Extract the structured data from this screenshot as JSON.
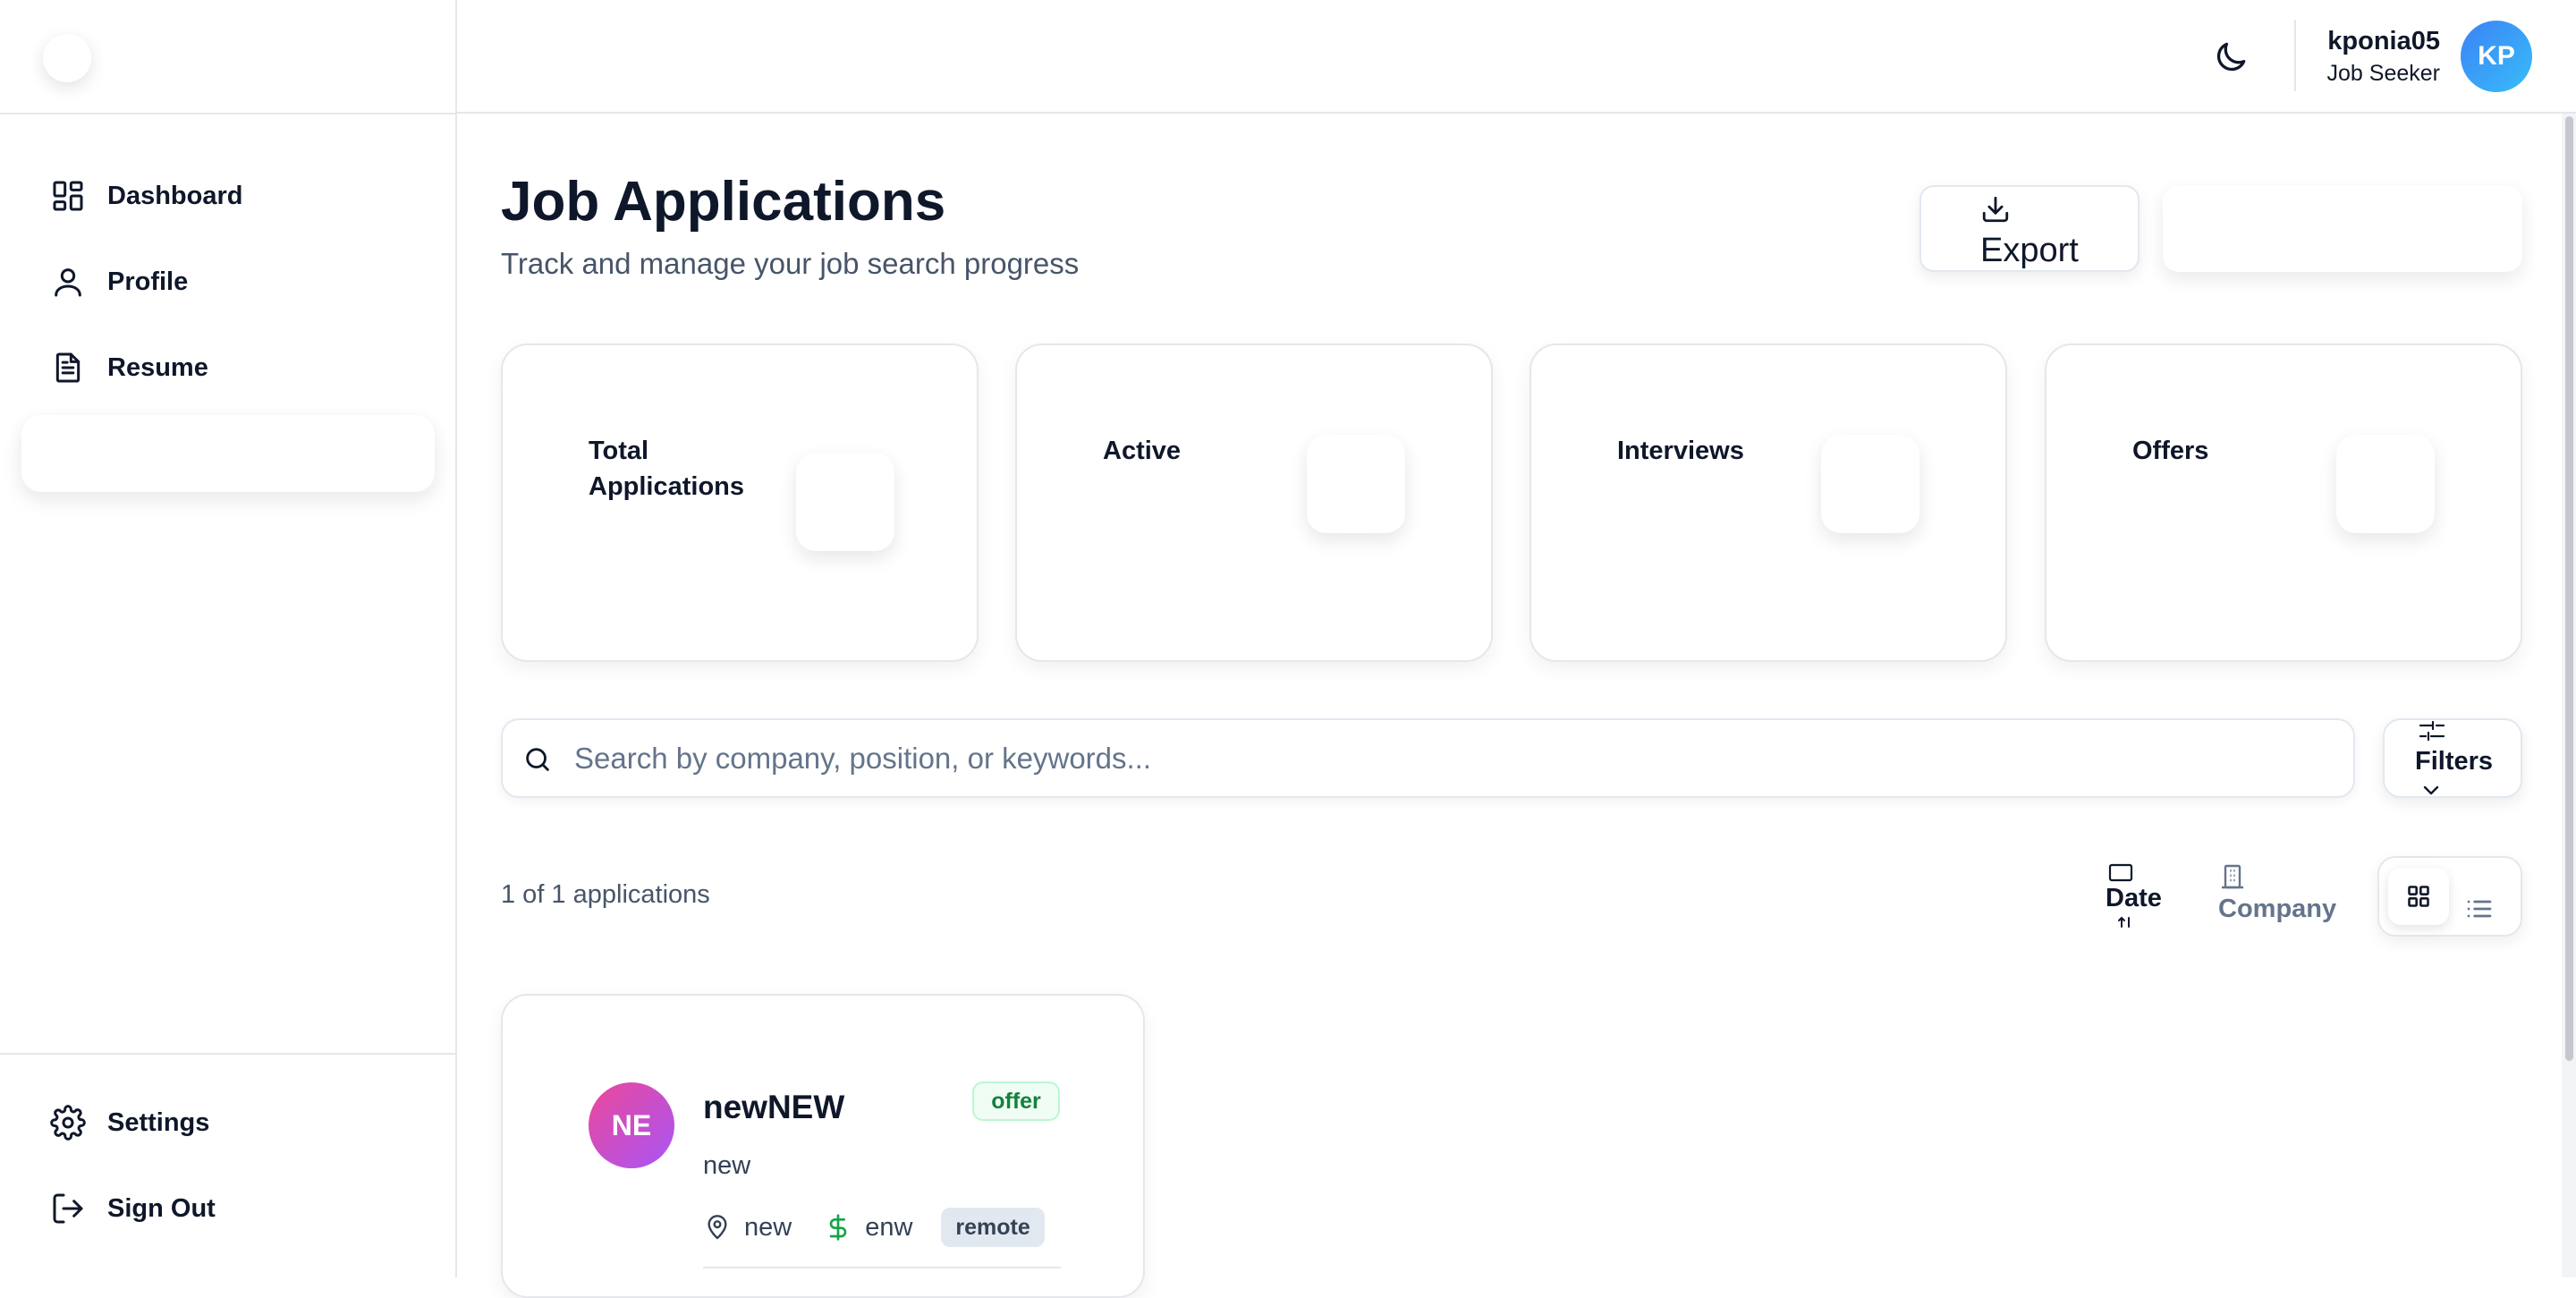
{
  "sidebar": {
    "items": [
      {
        "label": "Dashboard",
        "icon": "dashboard-icon"
      },
      {
        "label": "Profile",
        "icon": "user-icon"
      },
      {
        "label": "Resume",
        "icon": "document-icon"
      }
    ],
    "footer": [
      {
        "label": "Settings",
        "icon": "gear-icon"
      },
      {
        "label": "Sign Out",
        "icon": "sign-out-icon"
      }
    ]
  },
  "topbar": {
    "theme_icon": "moon-icon",
    "user": {
      "name": "kponia05",
      "role": "Job Seeker",
      "initials": "KP"
    }
  },
  "header": {
    "title": "Job Applications",
    "subtitle": "Track and manage your job search progress",
    "export_label": "Export"
  },
  "stats": [
    {
      "label": "Total Applications"
    },
    {
      "label": "Active"
    },
    {
      "label": "Interviews"
    },
    {
      "label": "Offers"
    }
  ],
  "search": {
    "placeholder": "Search by company, position, or keywords...",
    "value": ""
  },
  "filters": {
    "label": "Filters"
  },
  "results": {
    "count_text": "1 of 1 applications"
  },
  "sort": {
    "date_label": "Date",
    "company_label": "Company",
    "active": "date"
  },
  "view": {
    "active": "grid"
  },
  "applications": [
    {
      "initials": "NE",
      "company": "newNEW",
      "status": "offer",
      "position": "new",
      "location": "new",
      "salary": "enw",
      "work_type": "remote"
    }
  ],
  "colors": {
    "accent_blue": "#3b82f6",
    "status_offer": "#15803d",
    "avatar_gradient_start": "#ec4899",
    "avatar_gradient_end": "#a855f7",
    "salary_green": "#16a34a"
  }
}
